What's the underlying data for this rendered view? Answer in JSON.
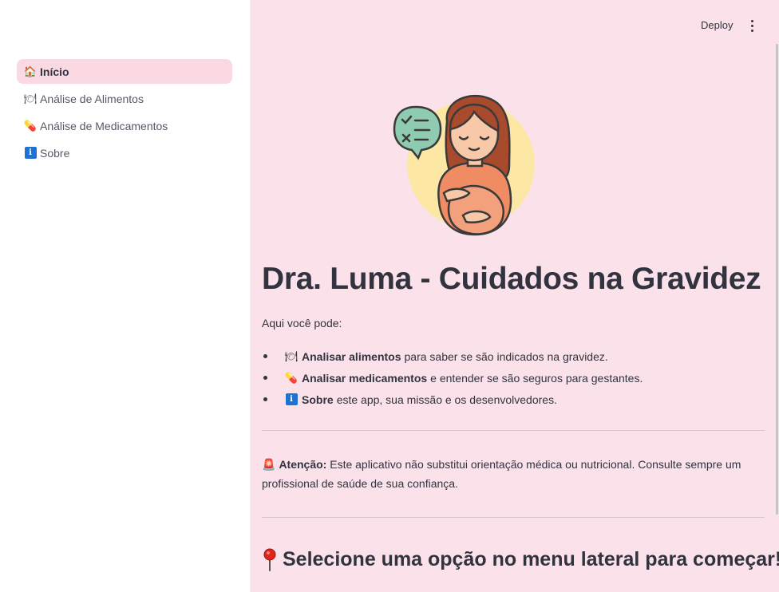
{
  "sidebar": {
    "items": [
      {
        "label": "Início",
        "icon": "house-icon",
        "glyph": "🏠",
        "active": true
      },
      {
        "label": "Análise de Alimentos",
        "icon": "plate-utensils-icon",
        "glyph": "🍽",
        "active": false
      },
      {
        "label": "Análise de Medicamentos",
        "icon": "pill-icon",
        "glyph": "💊",
        "active": false
      },
      {
        "label": "Sobre",
        "icon": "info-icon",
        "glyph": "i",
        "active": false
      }
    ]
  },
  "topbar": {
    "deploy_label": "Deploy",
    "menu_icon": "kebab-menu-icon"
  },
  "main": {
    "title": "Dra. Luma - Cuidados na Gravidez",
    "intro": "Aqui você pode:",
    "bullets": [
      {
        "icon": "plate-utensils-icon",
        "glyph": "🍽",
        "strong": "Analisar alimentos",
        "text": "para saber se são indicados na gravidez."
      },
      {
        "icon": "pill-icon",
        "glyph": "💊",
        "strong": "Analisar medicamentos",
        "text": "e entender se são seguros para gestantes."
      },
      {
        "icon": "info-icon",
        "glyph": "i",
        "strong": "Sobre",
        "text": "este app, sua missão e os desenvolvedores."
      }
    ],
    "warning": {
      "icon": "siren-icon",
      "glyph": "🚨",
      "strong": "Atenção:",
      "text": "Este aplicativo não substitui orientação médica ou nutricional. Consulte sempre um profissional de saúde de sua confiança."
    },
    "cta": {
      "icon": "pushpin-icon",
      "text": "Selecione uma opção no menu lateral para começar!"
    }
  },
  "colors": {
    "main_bg": "#fbe1ea",
    "active_nav_bg": "#fbd9e3",
    "sidebar_bg": "#ffffff"
  }
}
